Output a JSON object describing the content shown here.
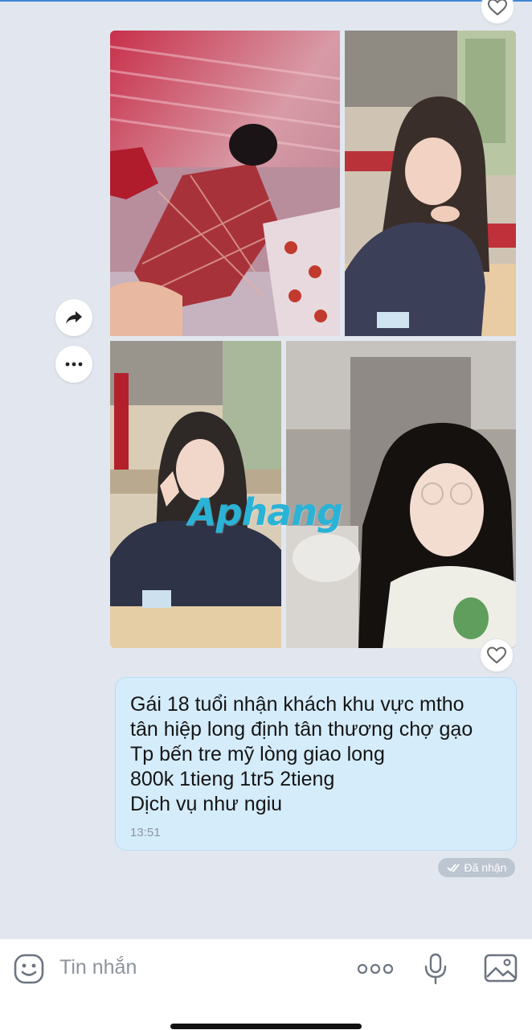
{
  "message": {
    "lines": [
      "Gái 18 tuổi nhận khách khu vực mtho",
      "tân hiệp long định tân thương chợ gạo",
      "Tp bến tre mỹ lòng giao long",
      "800k 1tieng 1tr5 2tieng",
      "Dịch vụ như ngiu"
    ],
    "time": "13:51",
    "status": "Đã nhận"
  },
  "watermark": "Aphang",
  "composer": {
    "placeholder": "Tin nhắn"
  },
  "icons": {
    "reaction": "heart-icon",
    "forward": "forward-arrow-icon",
    "more": "more-dots-icon",
    "emoji": "emoji-icon",
    "options": "options-dots-icon",
    "mic": "microphone-icon",
    "image": "image-icon"
  },
  "colors": {
    "background": "#e2e7ef",
    "bubble": "#d5ecfa",
    "watermark": "#2ab3d6"
  }
}
